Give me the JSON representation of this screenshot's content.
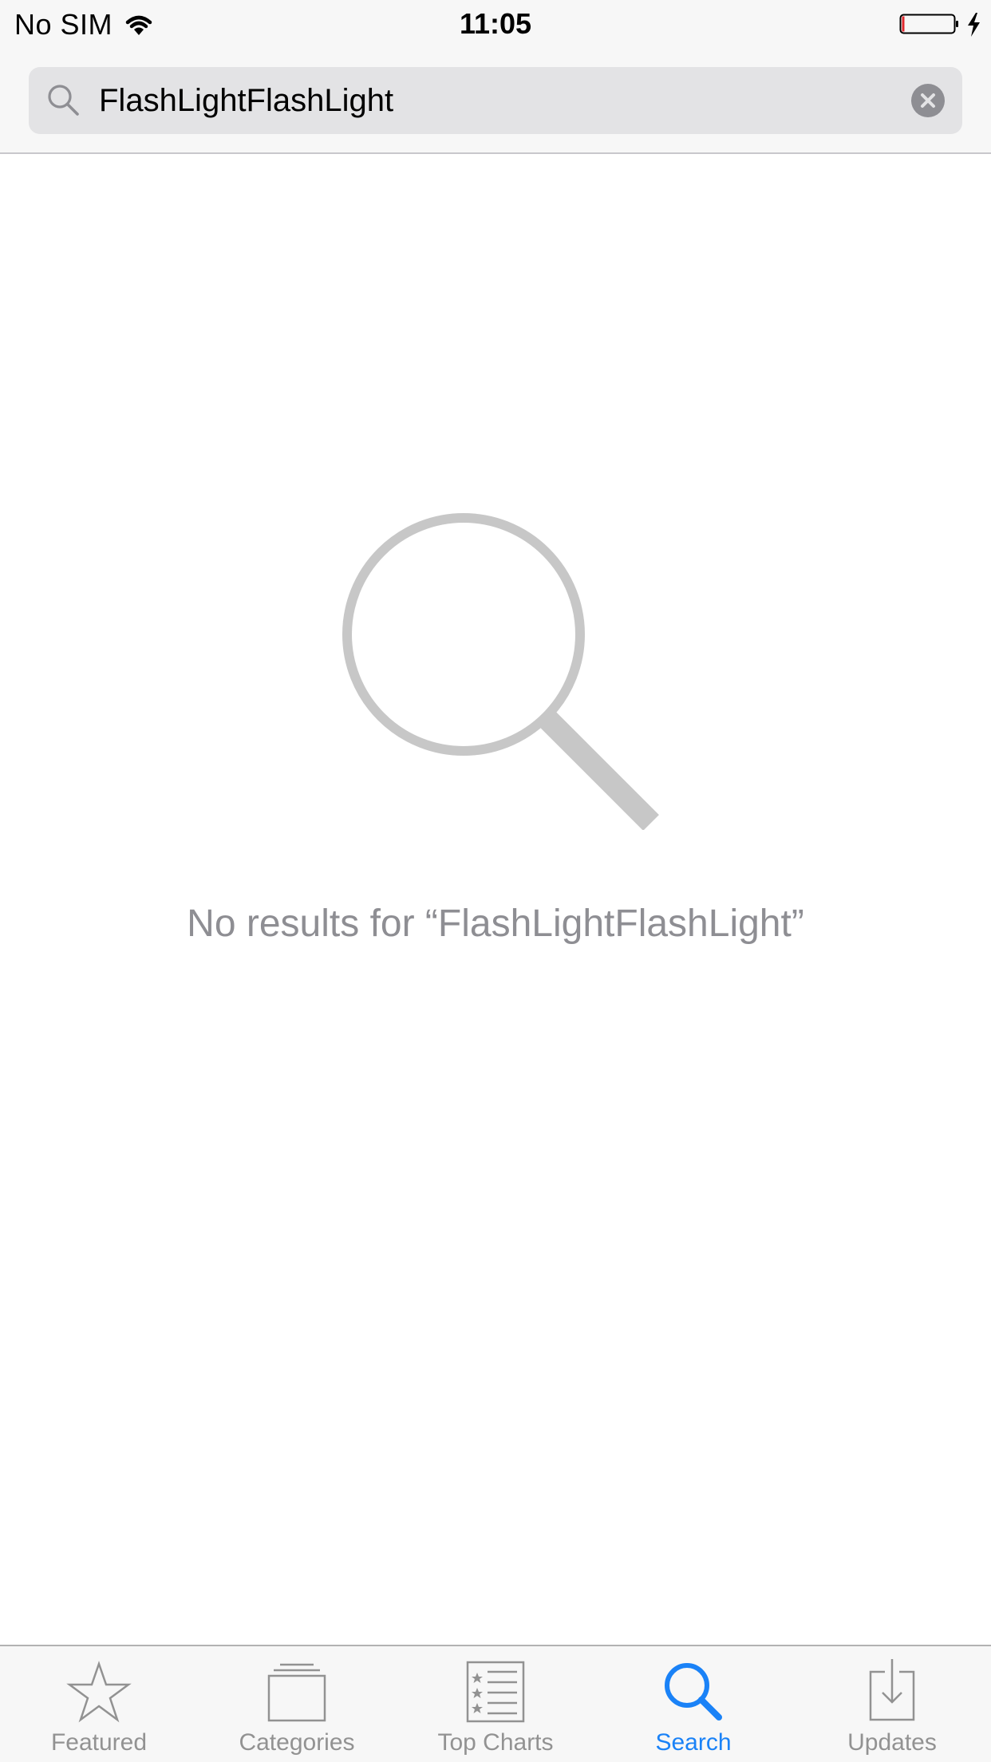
{
  "status_bar": {
    "carrier": "No SIM",
    "time": "11:05",
    "wifi_icon": "wifi-icon",
    "battery_icon": "battery-icon",
    "charging_icon": "bolt-icon"
  },
  "search": {
    "query": "FlashLightFlashLight",
    "search_icon": "search-icon",
    "clear_icon": "clear-icon"
  },
  "empty_state": {
    "icon": "magnifier-icon",
    "message": "No results for “FlashLightFlashLight”"
  },
  "tab_bar": {
    "active_tab": "Search",
    "active_color": "#1a82f7",
    "inactive_color": "#929292",
    "tabs": [
      {
        "label": "Featured",
        "icon": "star-icon"
      },
      {
        "label": "Categories",
        "icon": "categories-icon"
      },
      {
        "label": "Top Charts",
        "icon": "top-charts-icon"
      },
      {
        "label": "Search",
        "icon": "search-icon"
      },
      {
        "label": "Updates",
        "icon": "updates-icon"
      }
    ]
  }
}
